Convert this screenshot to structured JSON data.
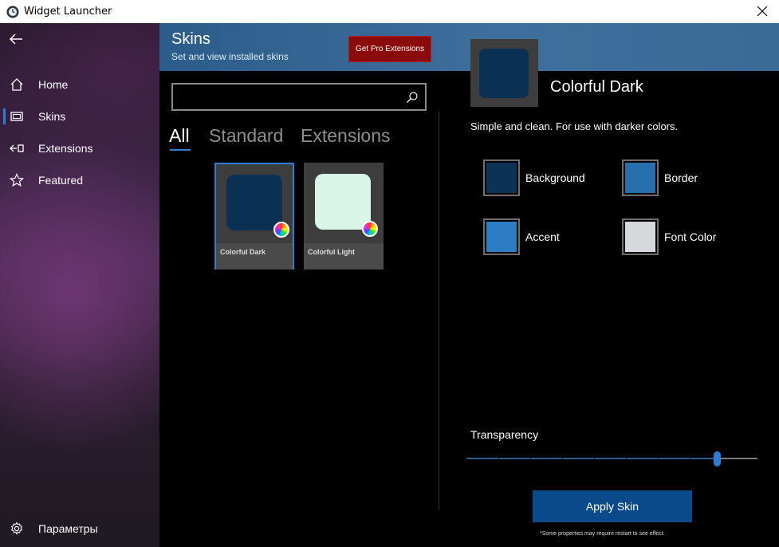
{
  "window": {
    "title": "Widget Launcher"
  },
  "sidebar": {
    "items": [
      {
        "label": "Home",
        "icon": "home-icon"
      },
      {
        "label": "Skins",
        "icon": "skins-icon",
        "active": true
      },
      {
        "label": "Extensions",
        "icon": "extensions-icon"
      },
      {
        "label": "Featured",
        "icon": "star-icon"
      }
    ],
    "settings_label": "Параметры"
  },
  "header": {
    "title": "Skins",
    "subtitle": "Set and view installed skins",
    "pro_button": "Get Pro Extensions"
  },
  "search": {
    "value": "",
    "placeholder": ""
  },
  "tabs": [
    {
      "label": "All",
      "active": true
    },
    {
      "label": "Standard"
    },
    {
      "label": "Extensions"
    }
  ],
  "skins": [
    {
      "name": "Colorful Dark",
      "swatch_color": "#0a3154",
      "selected": true
    },
    {
      "name": "Colorful Light",
      "swatch_color": "#d8f5e8",
      "selected": false
    }
  ],
  "detail": {
    "name": "Colorful Dark",
    "description": "Simple and clean. For use with darker colors.",
    "preview_color": "#0a3154",
    "colors": [
      {
        "label": "Background",
        "value": "#0b3355"
      },
      {
        "label": "Border",
        "value": "#2870ad"
      },
      {
        "label": "Accent",
        "value": "#2b7cc2"
      },
      {
        "label": "Font Color",
        "value": "#d5d8dc"
      }
    ],
    "transparency_label": "Transparency",
    "transparency_value": 0.87,
    "apply_button": "Apply Skin",
    "note": "*Some properties may require restart to see effect."
  },
  "colors": {
    "accent": "#2d7dd2",
    "header": "#2c5c8a",
    "pro_button": "#8b0a0a",
    "apply_button": "#0a4a8a"
  }
}
